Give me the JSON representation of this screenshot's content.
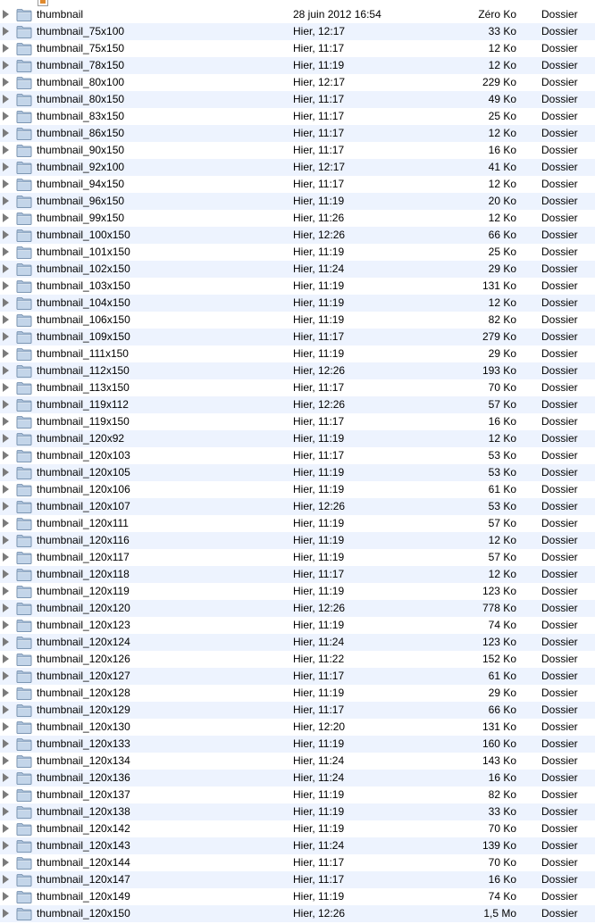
{
  "rows": [
    {
      "name": "thumbnail",
      "date": "28 juin 2012 16:54",
      "size": "Zéro Ko",
      "kind": "Dossier"
    },
    {
      "name": "thumbnail_75x100",
      "date": "Hier, 12:17",
      "size": "33 Ko",
      "kind": "Dossier"
    },
    {
      "name": "thumbnail_75x150",
      "date": "Hier, 11:17",
      "size": "12 Ko",
      "kind": "Dossier"
    },
    {
      "name": "thumbnail_78x150",
      "date": "Hier, 11:19",
      "size": "12 Ko",
      "kind": "Dossier"
    },
    {
      "name": "thumbnail_80x100",
      "date": "Hier, 12:17",
      "size": "229 Ko",
      "kind": "Dossier"
    },
    {
      "name": "thumbnail_80x150",
      "date": "Hier, 11:17",
      "size": "49 Ko",
      "kind": "Dossier"
    },
    {
      "name": "thumbnail_83x150",
      "date": "Hier, 11:17",
      "size": "25 Ko",
      "kind": "Dossier"
    },
    {
      "name": "thumbnail_86x150",
      "date": "Hier, 11:17",
      "size": "12 Ko",
      "kind": "Dossier"
    },
    {
      "name": "thumbnail_90x150",
      "date": "Hier, 11:17",
      "size": "16 Ko",
      "kind": "Dossier"
    },
    {
      "name": "thumbnail_92x100",
      "date": "Hier, 12:17",
      "size": "41 Ko",
      "kind": "Dossier"
    },
    {
      "name": "thumbnail_94x150",
      "date": "Hier, 11:17",
      "size": "12 Ko",
      "kind": "Dossier"
    },
    {
      "name": "thumbnail_96x150",
      "date": "Hier, 11:19",
      "size": "20 Ko",
      "kind": "Dossier"
    },
    {
      "name": "thumbnail_99x150",
      "date": "Hier, 11:26",
      "size": "12 Ko",
      "kind": "Dossier"
    },
    {
      "name": "thumbnail_100x150",
      "date": "Hier, 12:26",
      "size": "66 Ko",
      "kind": "Dossier"
    },
    {
      "name": "thumbnail_101x150",
      "date": "Hier, 11:19",
      "size": "25 Ko",
      "kind": "Dossier"
    },
    {
      "name": "thumbnail_102x150",
      "date": "Hier, 11:24",
      "size": "29 Ko",
      "kind": "Dossier"
    },
    {
      "name": "thumbnail_103x150",
      "date": "Hier, 11:19",
      "size": "131 Ko",
      "kind": "Dossier"
    },
    {
      "name": "thumbnail_104x150",
      "date": "Hier, 11:19",
      "size": "12 Ko",
      "kind": "Dossier"
    },
    {
      "name": "thumbnail_106x150",
      "date": "Hier, 11:19",
      "size": "82 Ko",
      "kind": "Dossier"
    },
    {
      "name": "thumbnail_109x150",
      "date": "Hier, 11:17",
      "size": "279 Ko",
      "kind": "Dossier"
    },
    {
      "name": "thumbnail_111x150",
      "date": "Hier, 11:19",
      "size": "29 Ko",
      "kind": "Dossier"
    },
    {
      "name": "thumbnail_112x150",
      "date": "Hier, 12:26",
      "size": "193 Ko",
      "kind": "Dossier"
    },
    {
      "name": "thumbnail_113x150",
      "date": "Hier, 11:17",
      "size": "70 Ko",
      "kind": "Dossier"
    },
    {
      "name": "thumbnail_119x112",
      "date": "Hier, 12:26",
      "size": "57 Ko",
      "kind": "Dossier"
    },
    {
      "name": "thumbnail_119x150",
      "date": "Hier, 11:17",
      "size": "16 Ko",
      "kind": "Dossier"
    },
    {
      "name": "thumbnail_120x92",
      "date": "Hier, 11:19",
      "size": "12 Ko",
      "kind": "Dossier"
    },
    {
      "name": "thumbnail_120x103",
      "date": "Hier, 11:17",
      "size": "53 Ko",
      "kind": "Dossier"
    },
    {
      "name": "thumbnail_120x105",
      "date": "Hier, 11:19",
      "size": "53 Ko",
      "kind": "Dossier"
    },
    {
      "name": "thumbnail_120x106",
      "date": "Hier, 11:19",
      "size": "61 Ko",
      "kind": "Dossier"
    },
    {
      "name": "thumbnail_120x107",
      "date": "Hier, 12:26",
      "size": "53 Ko",
      "kind": "Dossier"
    },
    {
      "name": "thumbnail_120x111",
      "date": "Hier, 11:19",
      "size": "57 Ko",
      "kind": "Dossier"
    },
    {
      "name": "thumbnail_120x116",
      "date": "Hier, 11:19",
      "size": "12 Ko",
      "kind": "Dossier"
    },
    {
      "name": "thumbnail_120x117",
      "date": "Hier, 11:19",
      "size": "57 Ko",
      "kind": "Dossier"
    },
    {
      "name": "thumbnail_120x118",
      "date": "Hier, 11:17",
      "size": "12 Ko",
      "kind": "Dossier"
    },
    {
      "name": "thumbnail_120x119",
      "date": "Hier, 11:19",
      "size": "123 Ko",
      "kind": "Dossier"
    },
    {
      "name": "thumbnail_120x120",
      "date": "Hier, 12:26",
      "size": "778 Ko",
      "kind": "Dossier"
    },
    {
      "name": "thumbnail_120x123",
      "date": "Hier, 11:19",
      "size": "74 Ko",
      "kind": "Dossier"
    },
    {
      "name": "thumbnail_120x124",
      "date": "Hier, 11:24",
      "size": "123 Ko",
      "kind": "Dossier"
    },
    {
      "name": "thumbnail_120x126",
      "date": "Hier, 11:22",
      "size": "152 Ko",
      "kind": "Dossier"
    },
    {
      "name": "thumbnail_120x127",
      "date": "Hier, 11:17",
      "size": "61 Ko",
      "kind": "Dossier"
    },
    {
      "name": "thumbnail_120x128",
      "date": "Hier, 11:19",
      "size": "29 Ko",
      "kind": "Dossier"
    },
    {
      "name": "thumbnail_120x129",
      "date": "Hier, 11:17",
      "size": "66 Ko",
      "kind": "Dossier"
    },
    {
      "name": "thumbnail_120x130",
      "date": "Hier, 12:20",
      "size": "131 Ko",
      "kind": "Dossier"
    },
    {
      "name": "thumbnail_120x133",
      "date": "Hier, 11:19",
      "size": "160 Ko",
      "kind": "Dossier"
    },
    {
      "name": "thumbnail_120x134",
      "date": "Hier, 11:24",
      "size": "143 Ko",
      "kind": "Dossier"
    },
    {
      "name": "thumbnail_120x136",
      "date": "Hier, 11:24",
      "size": "16 Ko",
      "kind": "Dossier"
    },
    {
      "name": "thumbnail_120x137",
      "date": "Hier, 11:19",
      "size": "82 Ko",
      "kind": "Dossier"
    },
    {
      "name": "thumbnail_120x138",
      "date": "Hier, 11:19",
      "size": "33 Ko",
      "kind": "Dossier"
    },
    {
      "name": "thumbnail_120x142",
      "date": "Hier, 11:19",
      "size": "70 Ko",
      "kind": "Dossier"
    },
    {
      "name": "thumbnail_120x143",
      "date": "Hier, 11:24",
      "size": "139 Ko",
      "kind": "Dossier"
    },
    {
      "name": "thumbnail_120x144",
      "date": "Hier, 11:17",
      "size": "70 Ko",
      "kind": "Dossier"
    },
    {
      "name": "thumbnail_120x147",
      "date": "Hier, 11:17",
      "size": "16 Ko",
      "kind": "Dossier"
    },
    {
      "name": "thumbnail_120x149",
      "date": "Hier, 11:19",
      "size": "74 Ko",
      "kind": "Dossier"
    },
    {
      "name": "thumbnail_120x150",
      "date": "Hier, 12:26",
      "size": "1,5 Mo",
      "kind": "Dossier"
    }
  ]
}
